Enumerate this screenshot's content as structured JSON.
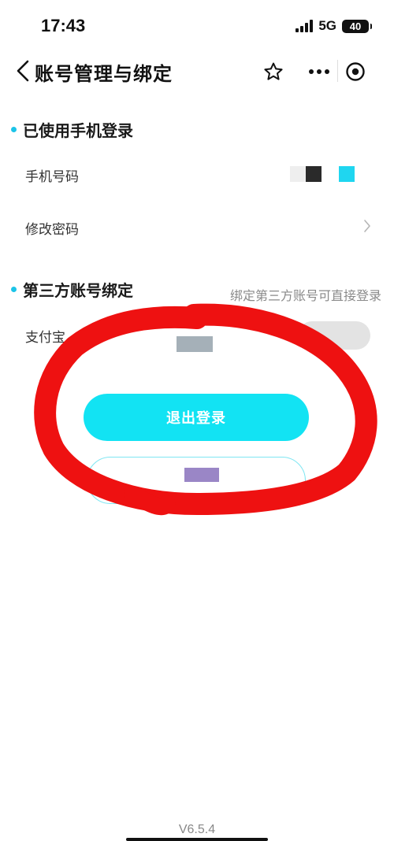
{
  "status_bar": {
    "time": "17:43",
    "network": "5G",
    "battery": "40"
  },
  "header": {
    "title": "账号管理与绑定",
    "icons": [
      "back-icon",
      "star-icon",
      "more-icon",
      "target-icon"
    ]
  },
  "phone_section": {
    "title": "已使用手机登录",
    "phone_label": "手机号码",
    "phone_value_colors": [
      "#eeeeee",
      "#2a2a2a",
      "#ffffff",
      "#1fd6f0"
    ],
    "change_password_label": "修改密码"
  },
  "third_party_section": {
    "title": "第三方账号绑定",
    "hint": "绑定第三方账号可直接登录",
    "alipay_label": "支付宝"
  },
  "actions": {
    "logout_label": "退出登录"
  },
  "footer": {
    "version": "V6.5.4"
  },
  "colors": {
    "accent": "#12e3f3",
    "annotation": "#ee1111"
  }
}
